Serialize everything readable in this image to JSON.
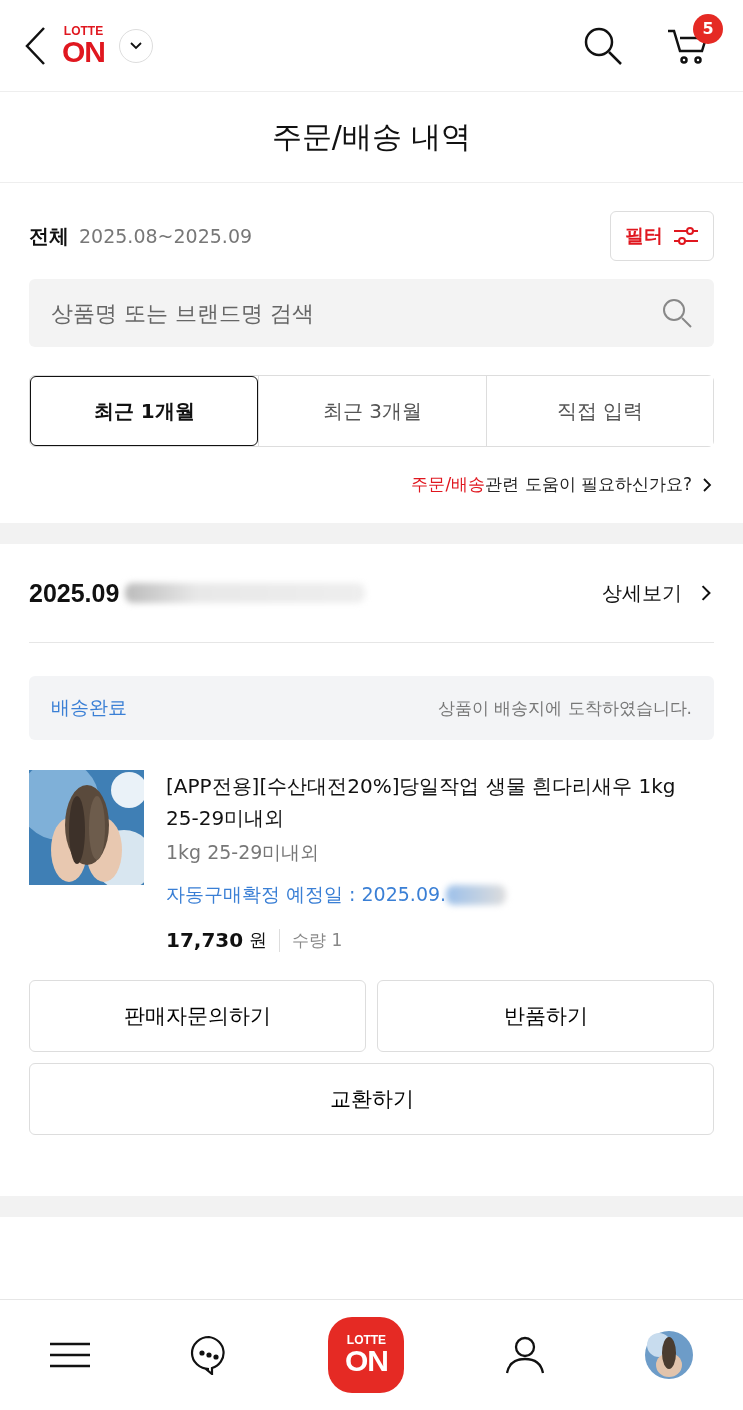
{
  "header": {
    "logo_top": "LOTTE",
    "logo_main": "ON",
    "cart_count": "5"
  },
  "title": "주문/배송 내역",
  "filter": {
    "scope": "전체",
    "range": "2025.08~2025.09",
    "filter_button": "필터",
    "search_placeholder": "상품명 또는 브랜드명 검색",
    "periods": [
      {
        "label": "최근 1개월",
        "selected": true
      },
      {
        "label": "최근 3개월",
        "selected": false
      },
      {
        "label": "직접 입력",
        "selected": false
      }
    ],
    "help_highlight": "주문/배송",
    "help_rest": "관련 도움이 필요하신가요?"
  },
  "order": {
    "date": "2025.09",
    "detail_link": "상세보기",
    "status": "배송완료",
    "status_message": "상품이 배송지에 도착하였습니다.",
    "product": {
      "kind": "picture",
      "name": "[APP전용][수산대전20%]당일작업 생물 흰다리새우 1kg 25-29미내외",
      "option": "1kg 25-29미내외",
      "confirm_date": "자동구매확정 예정일 : 2025.09.",
      "price": "17,730",
      "currency": "원",
      "quantity": "수량 1"
    },
    "actions": [
      {
        "label": "판매자문의하기"
      },
      {
        "label": "반품하기"
      },
      {
        "label": "교환하기"
      }
    ]
  },
  "bottom_nav": {
    "logo_top": "LOTTE",
    "logo_main": "ON"
  }
}
